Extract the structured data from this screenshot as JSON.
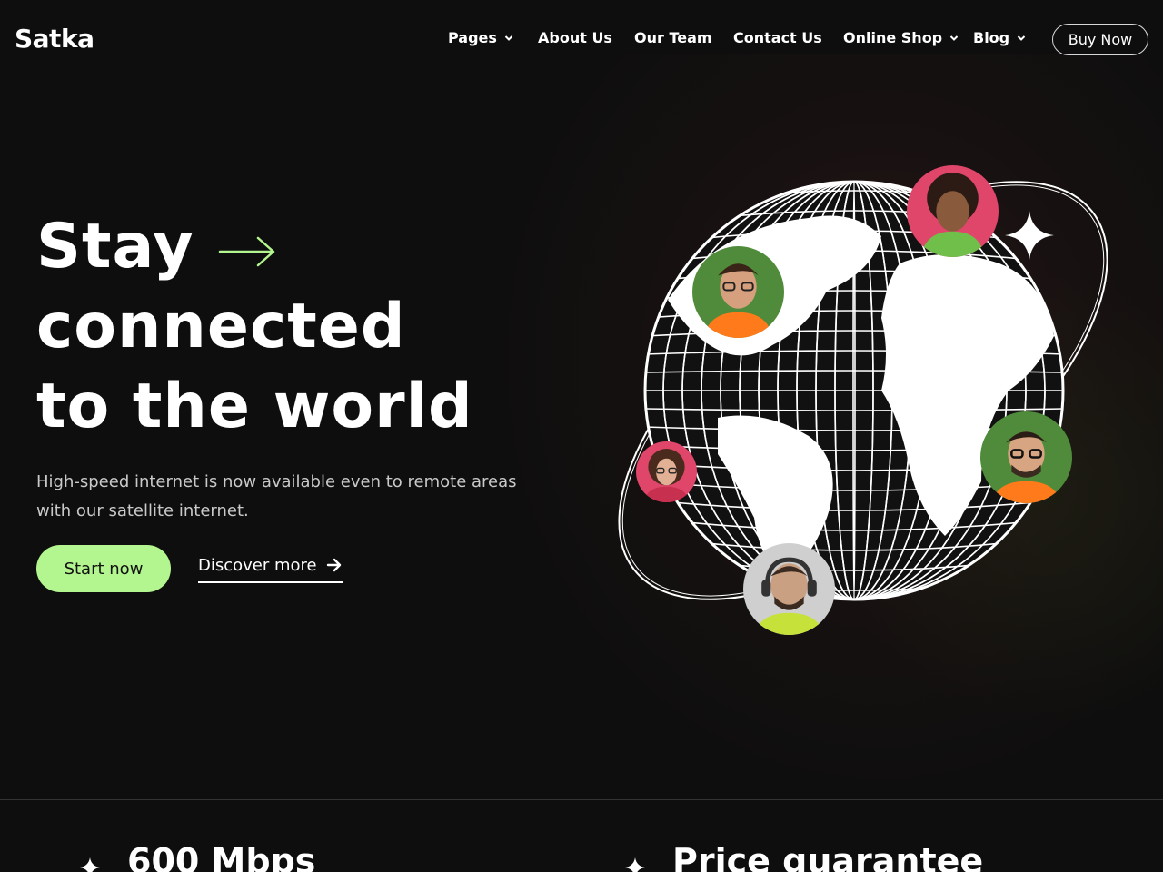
{
  "header": {
    "brand": "Satka",
    "nav": [
      {
        "label": "Pages",
        "has_dropdown": true
      },
      {
        "label": "About Us",
        "has_dropdown": false
      },
      {
        "label": "Our Team",
        "has_dropdown": false
      },
      {
        "label": "Contact Us",
        "has_dropdown": false
      },
      {
        "label": "Online Shop",
        "has_dropdown": true
      },
      {
        "label": "Blog",
        "has_dropdown": true
      }
    ],
    "cta": "Buy Now"
  },
  "hero": {
    "title_lines": [
      "Stay",
      "connected",
      "to the world"
    ],
    "description": "High-speed internet is now available even to remote areas with our satellite internet.",
    "primary_button": "Start now",
    "secondary_link": "Discover more",
    "accent_color": "#b3f58e"
  },
  "illustration": {
    "subject": "wireframe-globe-with-orbit",
    "avatars": [
      "curly-hair-woman",
      "glasses-man-green",
      "woman-glasses-red",
      "man-glasses-green",
      "man-headphones"
    ]
  },
  "stats": [
    {
      "title": "600 Mbps",
      "icon": "sparkle-icon"
    },
    {
      "title": "Price guarantee",
      "icon": "sparkle-icon"
    }
  ]
}
